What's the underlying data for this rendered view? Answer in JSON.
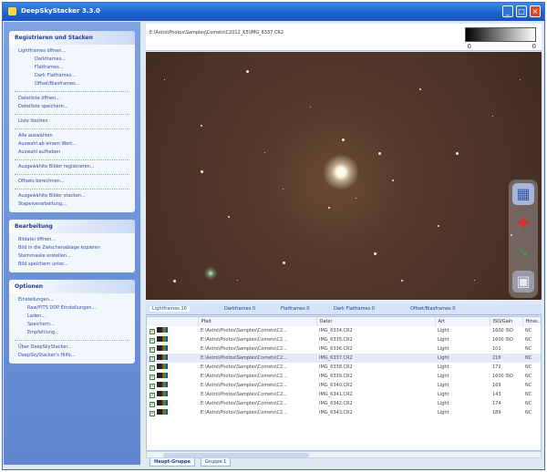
{
  "window": {
    "title": "DeepSkyStacker 3.3.0"
  },
  "sidebar": {
    "register": {
      "title": "Registrieren und Stacken",
      "items": [
        {
          "label": "Lightframes öffnen...",
          "level": 1
        },
        {
          "label": "Darkframes...",
          "level": 3
        },
        {
          "label": "Flatframes...",
          "level": 3
        },
        {
          "label": "Dark Flatframes...",
          "level": 3
        },
        {
          "label": "Offset/Biasframes...",
          "level": 3
        },
        {
          "label": "Dateiliste öffnen...",
          "level": 1,
          "sep_before": true
        },
        {
          "label": "Dateiliste speichern...",
          "level": 1
        },
        {
          "label": "Liste löschen",
          "level": 1,
          "sep_before": true
        },
        {
          "label": "Alle auswählen",
          "level": 1,
          "sep_before": true
        },
        {
          "label": "Auswahl ab einem Wert...",
          "level": 1
        },
        {
          "label": "Auswahl aufheben",
          "level": 1
        },
        {
          "label": "Ausgewählte Bilder registrieren...",
          "level": 1,
          "sep_before": true
        },
        {
          "label": "Offsets berechnen...",
          "level": 1,
          "sep_before": true
        },
        {
          "label": "Ausgewählte Bilder stacken...",
          "level": 1,
          "sep_before": true
        },
        {
          "label": "Stapelverarbeitung...",
          "level": 1
        }
      ]
    },
    "edit": {
      "title": "Bearbeitung",
      "items": [
        {
          "label": "Bildatei öffnen...",
          "level": 1
        },
        {
          "label": "Bild in die Zwischenablage kopieren",
          "level": 1
        },
        {
          "label": "Sternmaske erstellen...",
          "level": 1
        },
        {
          "label": "Bild speichern unter...",
          "level": 1
        }
      ]
    },
    "options": {
      "title": "Optionen",
      "items": [
        {
          "label": "Einstellungen...",
          "level": 1
        },
        {
          "label": "Raw/FITS DDP Einstellungen...",
          "level": 2
        },
        {
          "label": "Laden...",
          "level": 2
        },
        {
          "label": "Speichern...",
          "level": 2
        },
        {
          "label": "Empfehlung...",
          "level": 2
        },
        {
          "label": "Über DeepSkyStacker...",
          "level": 1,
          "sep_before": true
        },
        {
          "label": "DeepSkyStacker's Hilfe...",
          "level": 1
        }
      ]
    }
  },
  "viewer": {
    "path": "E:\\Astro\\Photos\\Samples\\Comets\\C2012_K5\\IMG_6337.CR2",
    "hist_low": "0",
    "hist_high": "0"
  },
  "file_tabs": [
    {
      "label": "Lightframes 10",
      "active": true
    },
    {
      "label": "Darkframes 0"
    },
    {
      "label": "Flatframes 0"
    },
    {
      "label": "Dark Flatframes 0"
    },
    {
      "label": "Offset/Biasframes 0"
    }
  ],
  "table": {
    "columns": [
      "",
      "Pfad",
      "Datei",
      "Art",
      "ISO/Gain",
      "Hinw..."
    ],
    "rows": [
      {
        "path": "E:\\Astro\\Photos\\Samples\\Comets\\C2...",
        "file": "IMG_6334.CR2",
        "type": "Light",
        "iso": "1600 ISO",
        "note": "NC",
        "selected": false
      },
      {
        "path": "E:\\Astro\\Photos\\Samples\\Comets\\C2...",
        "file": "IMG_6335.CR2",
        "type": "Light",
        "iso": "1600 ISO",
        "note": "NC",
        "selected": false
      },
      {
        "path": "E:\\Astro\\Photos\\Samples\\Comets\\C2...",
        "file": "IMG_6336.CR2",
        "type": "Light",
        "iso": "101",
        "note": "NC",
        "selected": false
      },
      {
        "path": "E:\\Astro\\Photos\\Samples\\Comets\\C2...",
        "file": "IMG_6337.CR2",
        "type": "Light",
        "iso": "216",
        "note": "NC",
        "selected": true
      },
      {
        "path": "E:\\Astro\\Photos\\Samples\\Comets\\C2...",
        "file": "IMG_6338.CR2",
        "type": "Light",
        "iso": "172",
        "note": "NC",
        "selected": false
      },
      {
        "path": "E:\\Astro\\Photos\\Samples\\Comets\\C2...",
        "file": "IMG_6339.CR2",
        "type": "Light",
        "iso": "1600 ISO",
        "note": "NC",
        "selected": false
      },
      {
        "path": "E:\\Astro\\Photos\\Samples\\Comets\\C2...",
        "file": "IMG_6340.CR2",
        "type": "Light",
        "iso": "169",
        "note": "NC",
        "selected": false
      },
      {
        "path": "E:\\Astro\\Photos\\Samples\\Comets\\C2...",
        "file": "IMG_6341.CR2",
        "type": "Light",
        "iso": "143",
        "note": "NC",
        "selected": false
      },
      {
        "path": "E:\\Astro\\Photos\\Samples\\Comets\\C2...",
        "file": "IMG_6342.CR2",
        "type": "Light",
        "iso": "174",
        "note": "NC",
        "selected": false
      },
      {
        "path": "E:\\Astro\\Photos\\Samples\\Comets\\C2...",
        "file": "IMG_6343.CR2",
        "type": "Light",
        "iso": "189",
        "note": "NC",
        "selected": false
      }
    ]
  },
  "group_tabs": [
    {
      "label": "Haupt-Gruppe",
      "active": true
    },
    {
      "label": "Gruppe 1"
    }
  ],
  "icons": {
    "minimize": "minimize-icon",
    "maximize": "maximize-icon",
    "close": "close-icon",
    "tools": [
      "stack-tool-icon",
      "crosshair-star-icon",
      "edit-comet-icon",
      "save-icon"
    ]
  },
  "colors": {
    "titlebar": "#1c5fcf",
    "sidebar": "#6a8fd6",
    "sky": "#553a2a"
  }
}
